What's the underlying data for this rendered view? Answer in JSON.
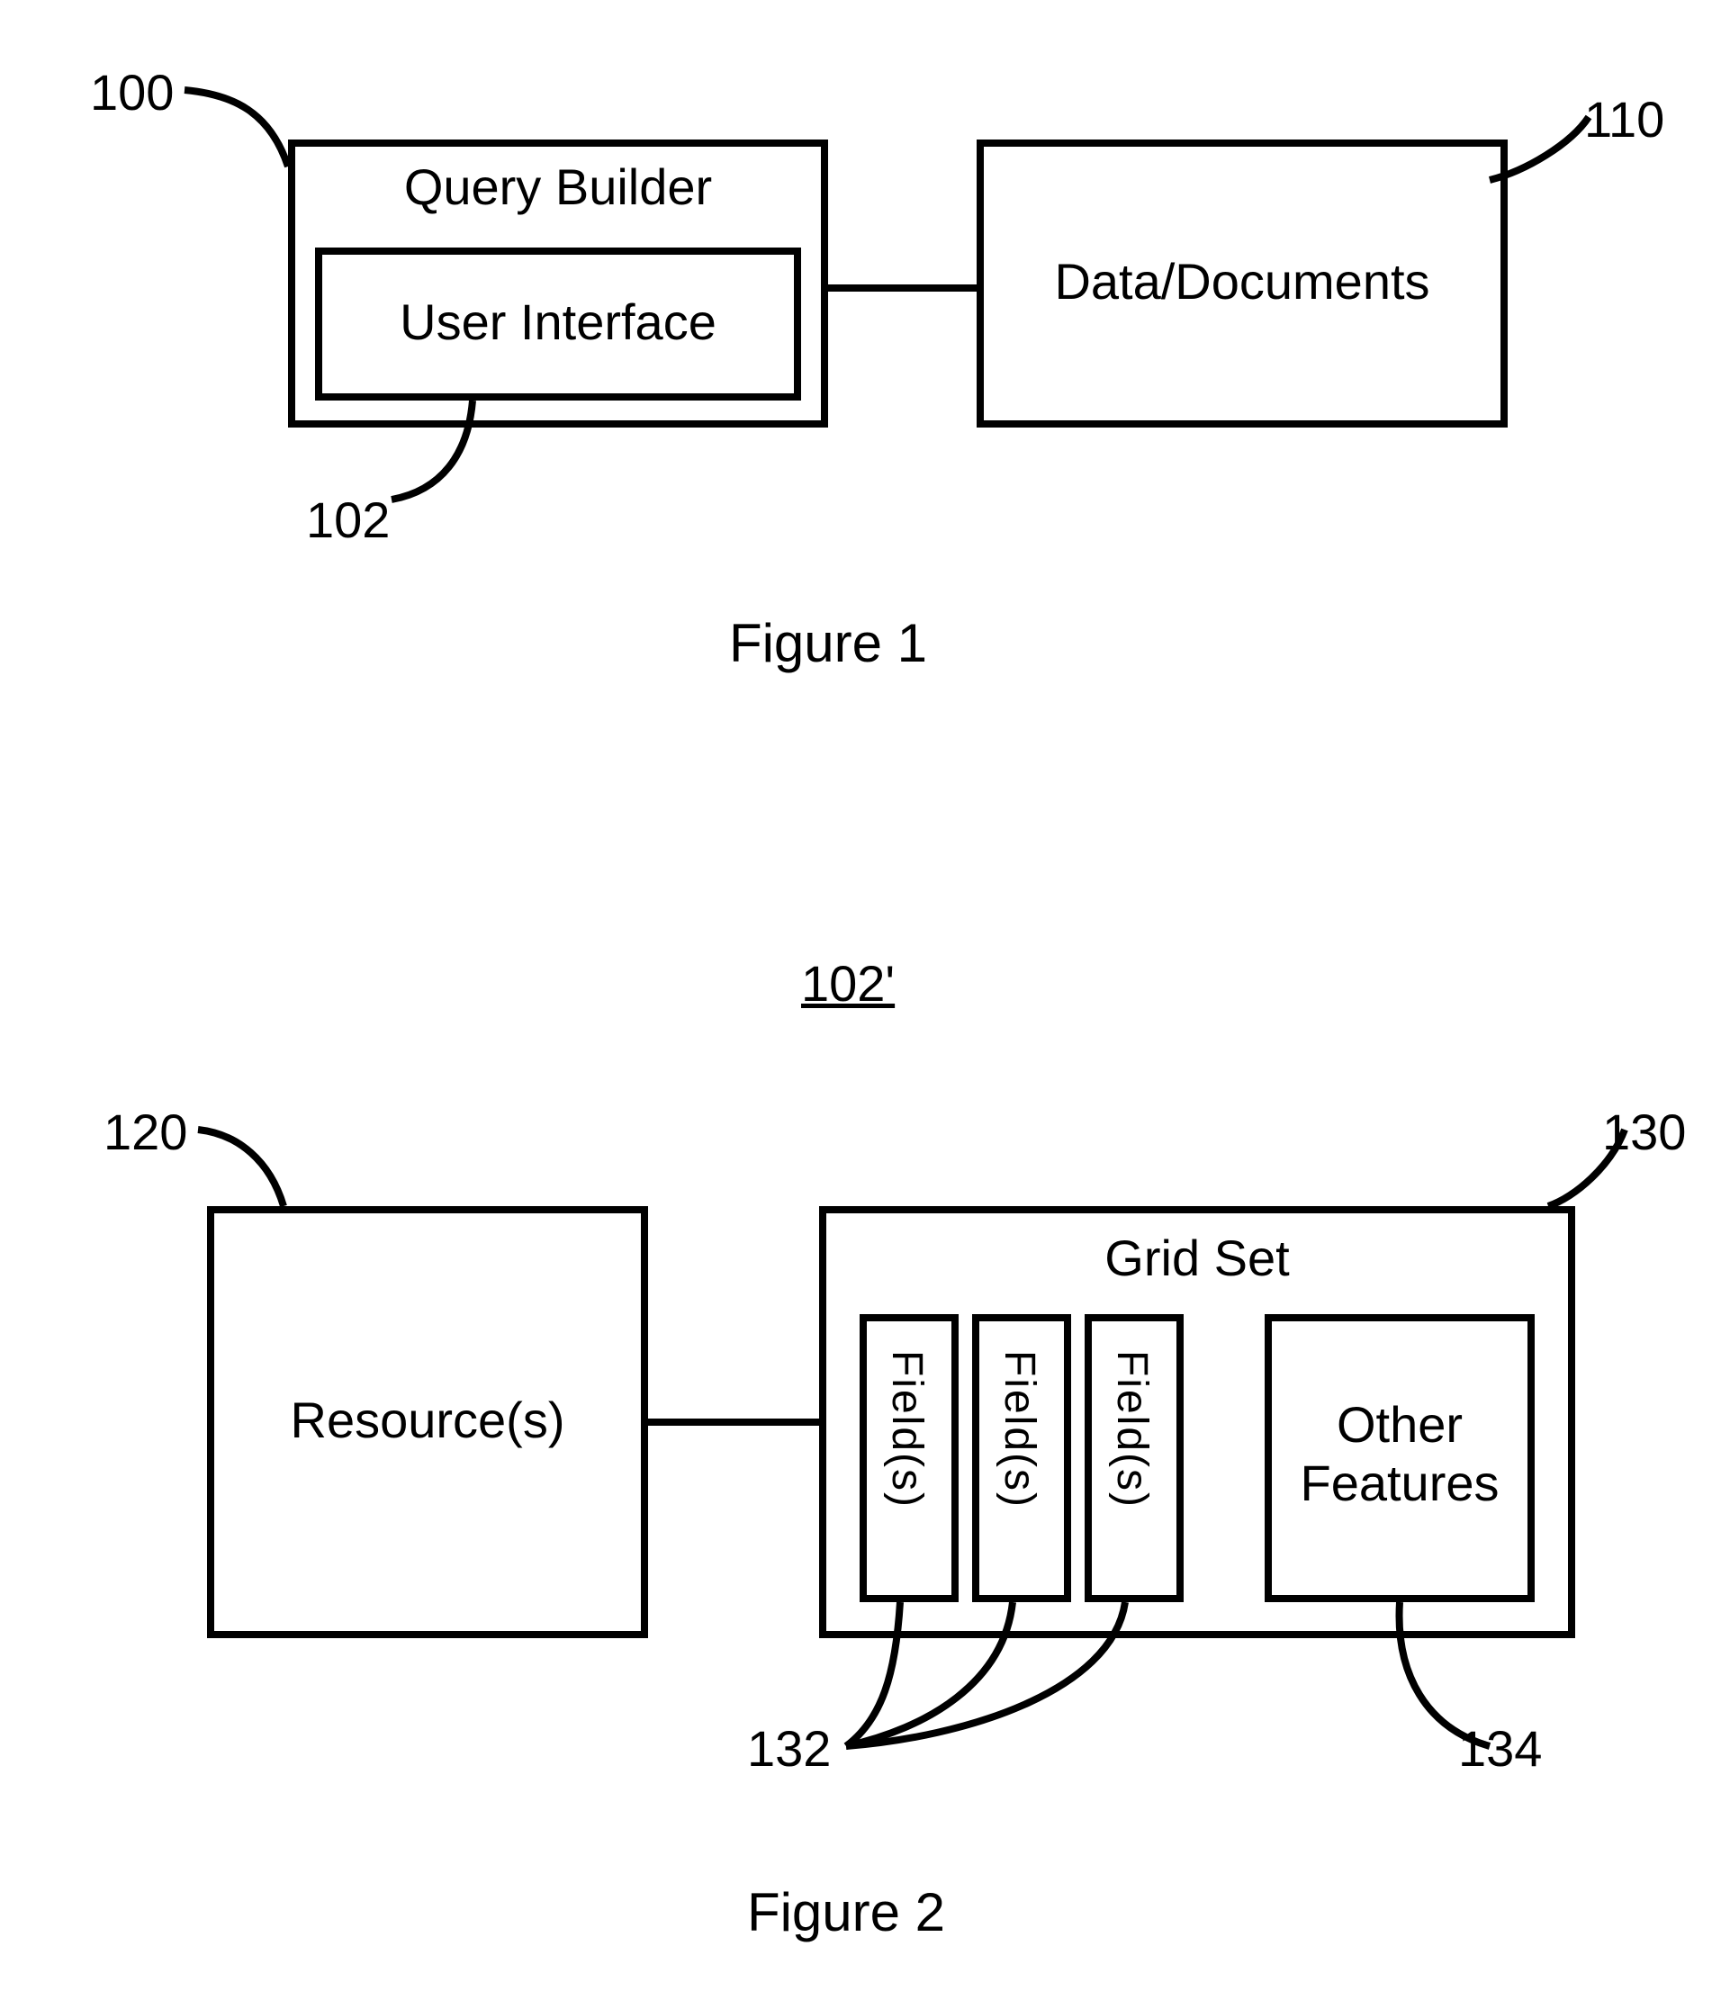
{
  "figure1": {
    "caption": "Figure 1",
    "ref_100": "100",
    "ref_102": "102",
    "ref_110": "110",
    "query_builder_title": "Query Builder",
    "user_interface_label": "User Interface",
    "data_documents_label": "Data/Documents"
  },
  "figure2": {
    "caption": "Figure 2",
    "title_ref": "102'",
    "ref_120": "120",
    "ref_130": "130",
    "ref_132": "132",
    "ref_134": "134",
    "resources_label": "Resource(s)",
    "grid_set_title": "Grid Set",
    "field_label_1": "Field(s)",
    "field_label_2": "Field(s)",
    "field_label_3": "Field(s)",
    "other_features_line1": "Other",
    "other_features_line2": "Features"
  }
}
